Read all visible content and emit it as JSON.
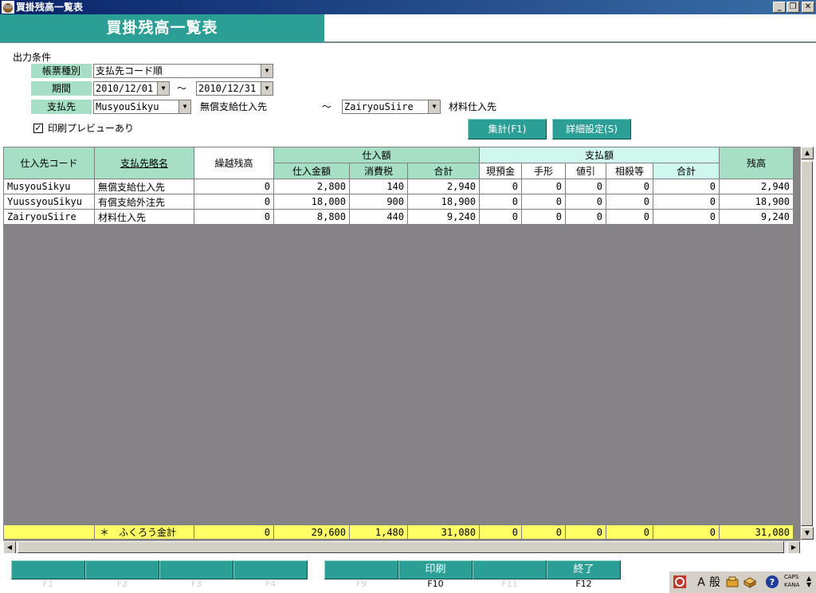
{
  "window": {
    "title": "買掛残高一覧表",
    "minimize": "_",
    "restore": "❐",
    "close": "✕"
  },
  "page_title": "買掛残高一覧表",
  "conditions": {
    "section_title": "出力条件",
    "report_type": {
      "label": "帳票種別",
      "value": "支払先コード順"
    },
    "period": {
      "label": "期間",
      "from": "2010/12/01",
      "sep": "〜",
      "to": "2010/12/31"
    },
    "payee": {
      "label": "支払先",
      "from_code": "MusyouSikyu",
      "from_name": "無償支給仕入先",
      "sep": "〜",
      "to_code": "ZairyouSiire",
      "to_name": "材料仕入先"
    },
    "print_preview": {
      "label": "印刷プレビューあり",
      "checked": true,
      "mark": "✓"
    }
  },
  "buttons": {
    "aggregate": "集計(F1)",
    "detail_settings": "詳細設定(S)"
  },
  "grid": {
    "headers": {
      "code": "仕入先コード",
      "short_name": "支払先略名",
      "carry_over": "繰越残高",
      "purchase_group": "仕入額",
      "purchase_amount": "仕入金額",
      "tax": "消費税",
      "purchase_total": "合計",
      "payment_group": "支払額",
      "cash": "現預金",
      "bill": "手形",
      "discount": "値引",
      "offset": "相殺等",
      "payment_total": "合計",
      "balance": "残高"
    },
    "rows": [
      {
        "code": "MusyouSikyu",
        "name": "無償支給仕入先",
        "carry": "0",
        "amount": "2,800",
        "tax": "140",
        "ptotal": "2,940",
        "cash": "0",
        "bill": "0",
        "discount": "0",
        "offset": "0",
        "paytotal": "0",
        "balance": "2,940"
      },
      {
        "code": "YuussyouSikyu",
        "name": "有償支給外注先",
        "carry": "0",
        "amount": "18,000",
        "tax": "900",
        "ptotal": "18,900",
        "cash": "0",
        "bill": "0",
        "discount": "0",
        "offset": "0",
        "paytotal": "0",
        "balance": "18,900"
      },
      {
        "code": "ZairyouSiire",
        "name": "材料仕入先",
        "carry": "0",
        "amount": "8,800",
        "tax": "440",
        "ptotal": "9,240",
        "cash": "0",
        "bill": "0",
        "discount": "0",
        "offset": "0",
        "paytotal": "0",
        "balance": "9,240"
      }
    ],
    "totals": {
      "label": "＊　ふくろう金計",
      "carry": "0",
      "amount": "29,600",
      "tax": "1,480",
      "ptotal": "31,080",
      "cash": "0",
      "bill": "0",
      "discount": "0",
      "offset": "0",
      "paytotal": "0",
      "balance": "31,080"
    }
  },
  "function_keys": [
    {
      "label": "",
      "caption": "F1"
    },
    {
      "label": "",
      "caption": "F2"
    },
    {
      "label": "",
      "caption": "F3"
    },
    {
      "label": "",
      "caption": "F4"
    },
    {
      "label": "",
      "caption": "F9"
    },
    {
      "label": "印刷",
      "caption": "F10"
    },
    {
      "label": "",
      "caption": "F11"
    },
    {
      "label": "終了",
      "caption": "F12"
    }
  ],
  "ime": {
    "mode": "A",
    "kanji": "般",
    "caps": "CAPS",
    "kana": "KANA"
  },
  "colors": {
    "accent_teal": "#2b9e95",
    "label_green": "#a6dfc6",
    "payment_header": "#cff7ee",
    "totals_yellow": "#ffff66",
    "grid_empty": "#858385"
  }
}
